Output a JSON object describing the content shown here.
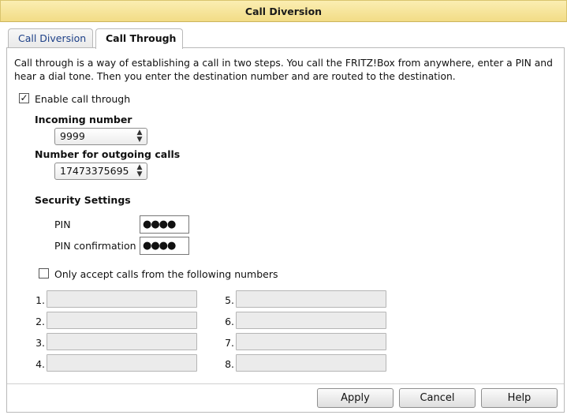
{
  "window": {
    "title": "Call Diversion"
  },
  "tabs": [
    {
      "label": "Call Diversion"
    },
    {
      "label": "Call Through"
    }
  ],
  "description": "Call through is a way of establishing a call in two steps. You call the FRITZ!Box from anywhere, enter a PIN and hear a dial tone. Then you enter the destination number and are routed to the destination.",
  "enable_call_through": {
    "label": "Enable call through",
    "checked": true,
    "mark": "✓"
  },
  "incoming": {
    "label": "Incoming number",
    "value": "9999"
  },
  "outgoing": {
    "label": "Number for outgoing calls",
    "value": "17473375695"
  },
  "security": {
    "heading": "Security Settings",
    "pin_label": "PIN",
    "pin_value": "●●●●",
    "pin_confirm_label": "PIN confirmation",
    "pin_confirm_value": "●●●●"
  },
  "only_accept": {
    "label": "Only accept calls from the following numbers",
    "checked": false
  },
  "numbers": [
    {
      "label": "1.",
      "value": ""
    },
    {
      "label": "2.",
      "value": ""
    },
    {
      "label": "3.",
      "value": ""
    },
    {
      "label": "4.",
      "value": ""
    },
    {
      "label": "5.",
      "value": ""
    },
    {
      "label": "6.",
      "value": ""
    },
    {
      "label": "7.",
      "value": ""
    },
    {
      "label": "8.",
      "value": ""
    }
  ],
  "buttons": {
    "apply": "Apply",
    "cancel": "Cancel",
    "help": "Help"
  },
  "icons": {
    "select_arrow": "up-down-chevron-icon",
    "checkmark": "checkmark-icon"
  },
  "colors": {
    "titlebar": "#f2dc86",
    "tab_inactive_text": "#1c3f87",
    "field_disabled": "#ebebeb"
  }
}
